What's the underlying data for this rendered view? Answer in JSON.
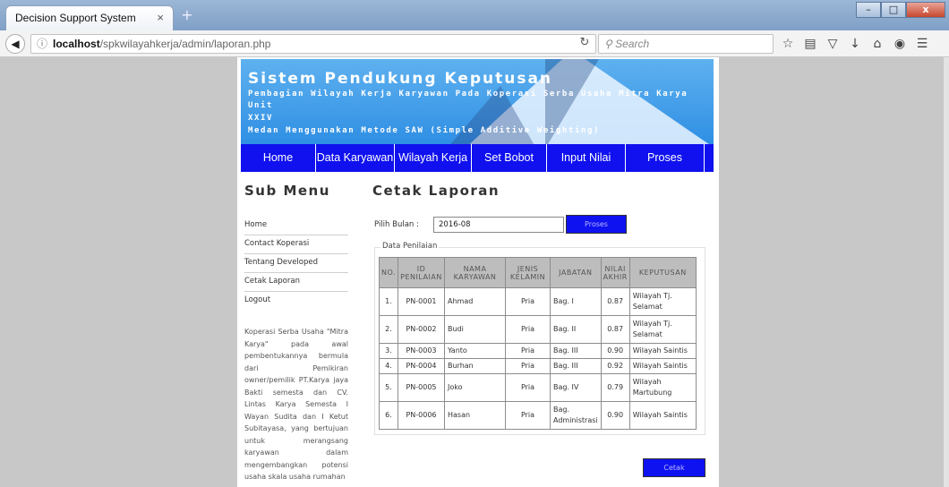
{
  "browser": {
    "tab_title": "Decision Support System",
    "tab_close": "×",
    "new_tab": "+",
    "url_host": "localhost",
    "url_path": "/spkwilayahkerja/admin/laporan.php",
    "search_placeholder": "Search",
    "window_buttons": [
      "–",
      "□",
      "x"
    ]
  },
  "banner": {
    "title": "Sistem Pendukung Keputusan",
    "subtitle_line1": "Pembagian Wilayah Kerja Karyawan Pada Koperasi Serba Usaha Mitra Karya Unit",
    "subtitle_line2": "XXIV",
    "subtitle_line3": "Medan Menggunakan Metode SAW (Simple Additive Weighting)"
  },
  "menu": {
    "items": [
      "Home",
      "Data Karyawan",
      "Wilayah Kerja",
      "Set Bobot",
      "Input Nilai",
      "Proses"
    ]
  },
  "sidebar": {
    "title": "Sub Menu",
    "links": [
      "Home",
      "Contact Koperasi",
      "Tentang Developed",
      "Cetak Laporan",
      "Logout"
    ],
    "description": "Koperasi Serba Usaha \"Mitra Karya\" pada awal pembentukannya bermula dari Pemikiran owner/pemilik PT.Karya jaya Bakti semesta dan CV. Lintas Karya Semesta I Wayan Sudita dan I Ketut Subitayasa, yang bertujuan untuk merangsang karyawan dalam mengembangkan potensi usaha skala usaha rumahan"
  },
  "content": {
    "title": "Cetak Laporan",
    "filter_label": "Pilih Bulan :",
    "filter_value": "2016-08",
    "proses_button": "Proses",
    "legend": "Data Penilaian",
    "cetak_button": "Cetak",
    "table": {
      "headers": [
        "NO.",
        "ID PENILAIAN",
        "NAMA KARYAWAN",
        "JENIS KELAMIN",
        "JABATAN",
        "NILAI AKHIR",
        "KEPUTUSAN"
      ],
      "rows": [
        [
          "1.",
          "PN-0001",
          "Ahmad",
          "Pria",
          "Bag. I",
          "0.87",
          "Wilayah Tj. Selamat"
        ],
        [
          "2.",
          "PN-0002",
          "Budi",
          "Pria",
          "Bag. II",
          "0.87",
          "Wilayah Tj. Selamat"
        ],
        [
          "3.",
          "PN-0003",
          "Yanto",
          "Pria",
          "Bag. III",
          "0.90",
          "Wilayah Saintis"
        ],
        [
          "4.",
          "PN-0004",
          "Burhan",
          "Pria",
          "Bag. III",
          "0.92",
          "Wilayah Saintis"
        ],
        [
          "5.",
          "PN-0005",
          "Joko",
          "Pria",
          "Bag. IV",
          "0.79",
          "Wilayah Martubung"
        ],
        [
          "6.",
          "PN-0006",
          "Hasan",
          "Pria",
          "Bag. Administrasi",
          "0.90",
          "Wilayah Saintis"
        ]
      ]
    }
  },
  "colors": {
    "menu_bg": "#1011ee",
    "banner_top": "#5fb1ef",
    "banner_bottom": "#2f8fe4",
    "button_bg": "#0e12f0",
    "table_header_bg": "#bdbdbd"
  }
}
